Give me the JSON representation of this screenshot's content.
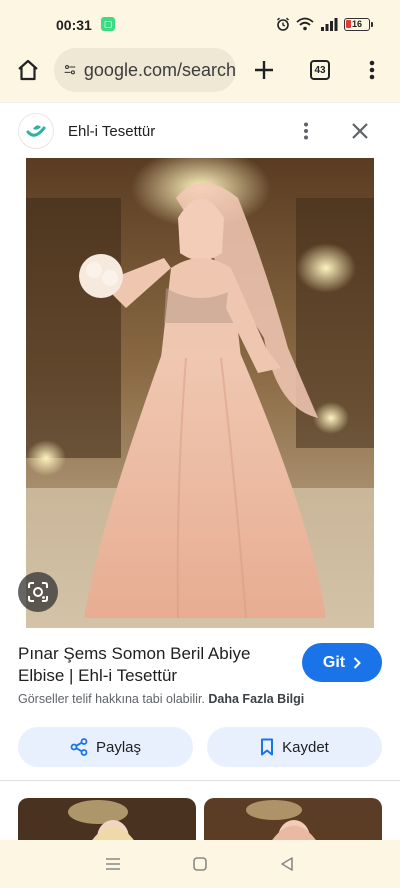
{
  "status_bar": {
    "time": "00:31",
    "battery": "16"
  },
  "browser": {
    "url": "google.com/search",
    "tab_count": "43"
  },
  "sheet": {
    "site_name": "Ehl-i Tesettür"
  },
  "result": {
    "title": "Pınar Şems Somon Beril Abiye Elbise | Ehl-i Tesettür",
    "go_label": "Git",
    "copyright": "Görseller telif hakkına tabi olabilir.",
    "more_info": "Daha Fazla Bilgi"
  },
  "actions": {
    "share_label": "Paylaş",
    "save_label": "Kaydet"
  },
  "icons": {
    "home": "home-icon",
    "site_settings": "tune-icon",
    "new_tab": "plus-icon",
    "menu": "more-vert-icon",
    "lens": "google-lens-icon",
    "share": "share-icon",
    "save": "bookmark-icon",
    "close": "close-icon"
  },
  "colors": {
    "accent": "#1a73e8",
    "pill_bg": "#e8f0fe",
    "chrome_bg": "#fdf6e3"
  }
}
